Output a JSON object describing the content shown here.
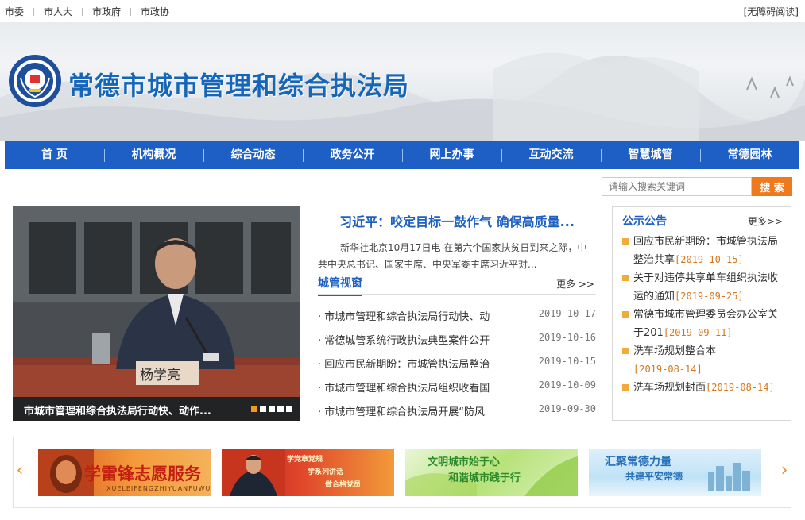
{
  "topbar": {
    "links": [
      "市委",
      "市人大",
      "市政府",
      "市政协"
    ],
    "accessibility": "[无障碍阅读]"
  },
  "banner": {
    "site_title": "常德市城市管理和综合执法局"
  },
  "nav": {
    "items": [
      "首 页",
      "机构概况",
      "综合动态",
      "政务公开",
      "网上办事",
      "互动交流",
      "智慧城管",
      "常德园林"
    ]
  },
  "search": {
    "placeholder": "请输入搜索关键词",
    "button": "搜 索"
  },
  "slideshow": {
    "caption": "市城市管理和综合执法局行动快、动作...",
    "nameplate": "杨学亮",
    "dot_count": 5,
    "active_dot": 0
  },
  "headline": {
    "title": "习近平：咬定目标一鼓作气 确保高质量...",
    "summary": "新华社北京10月17日电 在第六个国家扶贫日到来之际，中共中央总书记、国家主席、中央军委主席习近平对..."
  },
  "news": {
    "label": "城管视窗",
    "more": "更多 >>",
    "items": [
      {
        "title": "· 市城市管理和综合执法局行动快、动",
        "date": "2019-10-17"
      },
      {
        "title": "· 常德城管系统行政执法典型案件公开",
        "date": "2019-10-16"
      },
      {
        "title": "· 回应市民新期盼：市城管执法局整治",
        "date": "2019-10-15"
      },
      {
        "title": "· 市城市管理和综合执法局组织收看国",
        "date": "2019-10-09"
      },
      {
        "title": "· 市城市管理和综合执法局开展“防风",
        "date": "2019-09-30"
      }
    ]
  },
  "notice": {
    "label": "公示公告",
    "more": "更多>>",
    "items": [
      {
        "title": "回应市民新期盼：市城管执法局整治共享",
        "date": "[2019-10-15]"
      },
      {
        "title": "关于对违停共享单车组织执法收运的通知",
        "date": "[2019-09-25]"
      },
      {
        "title": "常德市城市管理委员会办公室关于201",
        "date": "[2019-09-11]"
      },
      {
        "title": "洗车场规划整合本",
        "date": "[2019-08-14]"
      },
      {
        "title": "洗车场规划封面",
        "date": "[2019-08-14]"
      }
    ]
  },
  "ads": {
    "ad1_title": "学雷锋志愿服务",
    "ad1_sub": "XUELEIFENGZHIYUANFUWU",
    "ad2_line1": "学党章党规",
    "ad2_line2": "学系列讲话",
    "ad2_line3": "做合格党员",
    "ad3_line1": "文明城市始于心",
    "ad3_line2": "和谐城市践于行",
    "ad4_line1": "汇聚常德力量",
    "ad4_line2": "共建平安常德"
  },
  "colors": {
    "primary_blue": "#1d5fc4",
    "accent_orange": "#ef7a1e"
  }
}
